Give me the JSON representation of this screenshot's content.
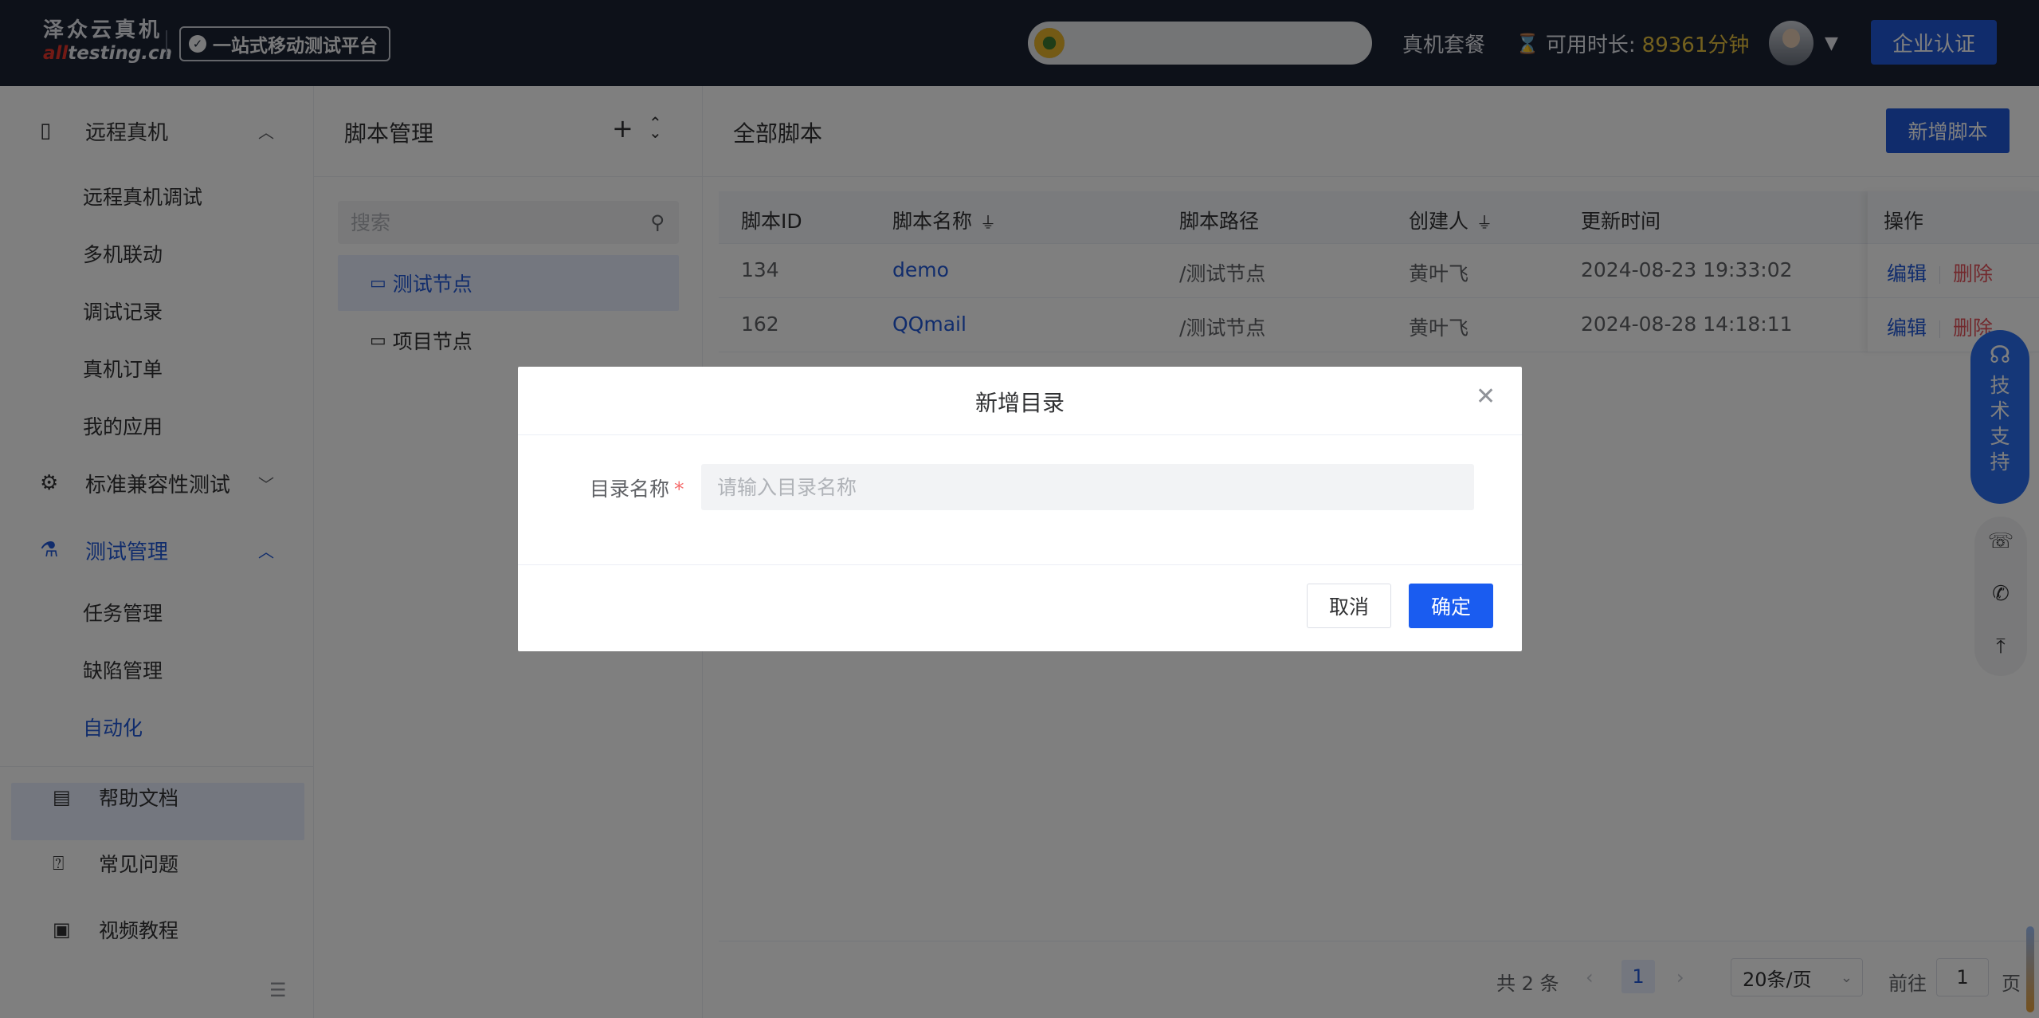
{
  "header": {
    "logo_cn": "泽众云真机",
    "logo_en_red": "all",
    "logo_en_rest": "testing.cn",
    "platform_badge": "一站式移动测试平台",
    "plan_link": "真机套餐",
    "duration_label": "可用时长:",
    "duration_value": "89361分钟",
    "enterprise_button": "企业认证"
  },
  "sidebar": {
    "groups": [
      {
        "label": "远程真机",
        "icon": "device-icon",
        "expanded": true
      },
      {
        "label": "标准兼容性测试",
        "icon": "gear-icon",
        "expanded": false
      },
      {
        "label": "测试管理",
        "icon": "flask-icon",
        "expanded": true
      }
    ],
    "remote_items": [
      "远程真机调试",
      "多机联动",
      "调试记录",
      "真机订单",
      "我的应用"
    ],
    "test_items": [
      "任务管理",
      "缺陷管理",
      "自动化"
    ],
    "help_items": [
      {
        "label": "帮助文档",
        "icon": "book-icon"
      },
      {
        "label": "常见问题",
        "icon": "question-icon"
      },
      {
        "label": "视频教程",
        "icon": "video-icon"
      }
    ]
  },
  "tree": {
    "title": "脚本管理",
    "search_placeholder": "搜索",
    "nodes": [
      "测试节点",
      "项目节点"
    ]
  },
  "main": {
    "title": "全部脚本",
    "add_button": "新增脚本",
    "columns": [
      "脚本ID",
      "脚本名称",
      "脚本路径",
      "创建人",
      "更新时间",
      "操作"
    ],
    "rows": [
      {
        "id": "134",
        "name": "demo",
        "path": "/测试节点",
        "creator": "黄叶飞",
        "updated": "2024-08-23 19:33:02"
      },
      {
        "id": "162",
        "name": "QQmail",
        "path": "/测试节点",
        "creator": "黄叶飞",
        "updated": "2024-08-28 14:18:11"
      }
    ],
    "op_edit": "编辑",
    "op_delete": "删除"
  },
  "pager": {
    "total": "共 2 条",
    "current_page": "1",
    "page_size": "20条/页",
    "goto_label": "前往",
    "goto_value": "1",
    "unit": "页"
  },
  "float": {
    "support_text": [
      "技",
      "术",
      "支",
      "持"
    ]
  },
  "dialog": {
    "title": "新增目录",
    "field_label": "目录名称",
    "required_mark": "*",
    "field_placeholder": "请输入目录名称",
    "cancel": "取消",
    "confirm": "确定"
  },
  "colors": {
    "topbar_bg": "#1b2233",
    "accent": "#2058d8",
    "duration_value": "#e8c23d",
    "danger": "#e4525a"
  }
}
